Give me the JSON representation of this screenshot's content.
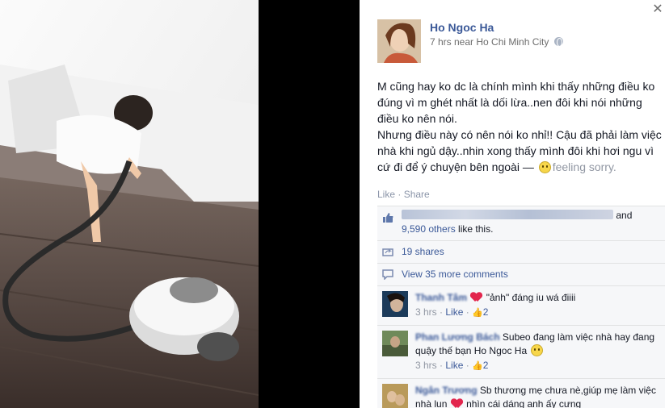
{
  "post": {
    "author": "Ho Ngoc Ha",
    "meta": "7 hrs near Ho Chi Minh City",
    "text_paragraph_1": "M cũng hay ko dc là chính mình khi thấy những điều ko đúng vì m ghét nhất là dối lừa..nen đôi khi nói những điều ko nên nói.",
    "text_paragraph_2_a": "Nhưng điều này có nên nói ko nhỉ!! Cậu đã phải làm việc nhà khi ngủ dậy..nhin xong thấy mình đôi khi hơi ngu vì cứ đi để ý chuyện bên ngoài —",
    "feeling": "feeling sorry.",
    "like_label": "Like",
    "share_label": "Share",
    "action_separator": " · "
  },
  "ufi": {
    "likes_suffix": "and",
    "likes_count": "9,590 others",
    "likes_tail": " like this.",
    "shares": "19 shares",
    "view_comments": "View 35 more comments"
  },
  "comments": [
    {
      "name": "Thanh Tâm",
      "text_before": "\"ảnh\" đáng iu wá điiii",
      "time": "3 hrs",
      "like": "Like",
      "likes": "2"
    },
    {
      "name": "Phan Lương Bách",
      "text_a": "Subeo đang làm việc nhà hay đang quậy thế bạn",
      "mention": "Ho Ngoc Ha",
      "time": "3 hrs",
      "like": "Like",
      "likes": "2"
    },
    {
      "name": "Ngân Trương",
      "text_a": "Sb thương mẹ chưa nè,giúp mẹ làm việc nhà lun",
      "text_b": "nhìn cái dáng anh ấy cưng"
    }
  ],
  "icons": {
    "close": "close-icon",
    "globe": "globe-icon",
    "like": "thumbs-up-icon",
    "share": "share-icon",
    "comment": "comment-icon"
  },
  "colors": {
    "link": "#3b5998",
    "muted": "#9197a3",
    "panel_bg": "#f6f7f9"
  }
}
